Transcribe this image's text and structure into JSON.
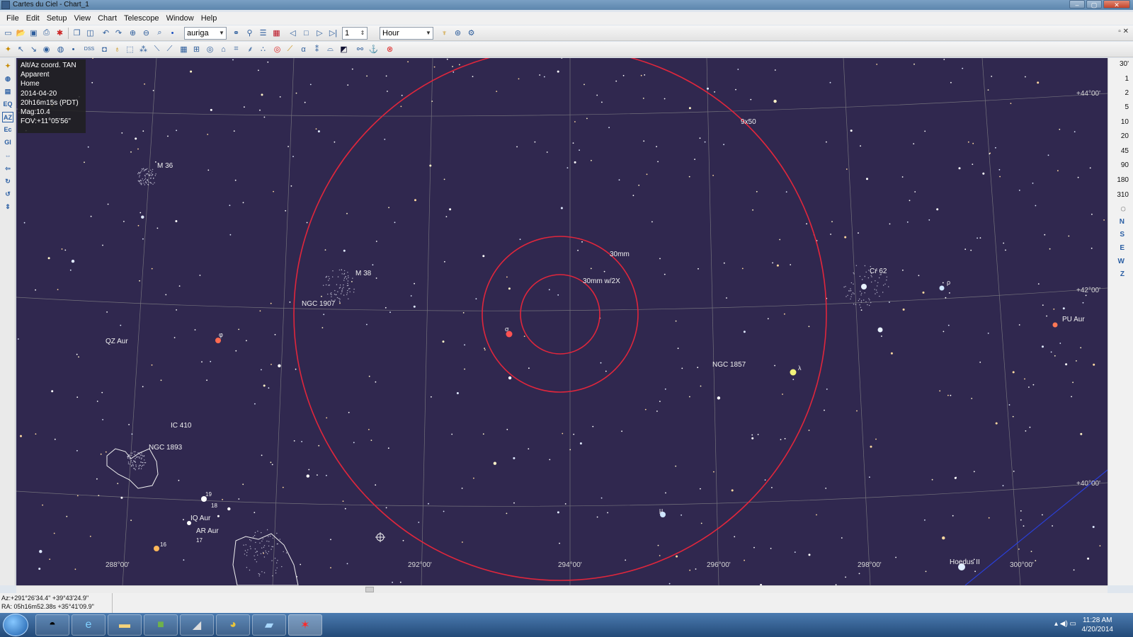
{
  "window": {
    "title": "Cartes du Ciel - Chart_1"
  },
  "menu": [
    "File",
    "Edit",
    "Setup",
    "View",
    "Chart",
    "Telescope",
    "Window",
    "Help"
  ],
  "toolbar": {
    "search_value": "auriga",
    "step_value": "1",
    "time_unit": "Hour",
    "dss_label": "DSS"
  },
  "left_toolbar": [
    "EQ",
    "AZ",
    "Ec",
    "Gl"
  ],
  "fov_scale": [
    "30'",
    "1",
    "2",
    "5",
    "10",
    "20",
    "45",
    "90",
    "180",
    "310"
  ],
  "directions": [
    "N",
    "S",
    "E",
    "W",
    "Z"
  ],
  "info": [
    "Alt/Az coord. TAN",
    "Apparent",
    "Home",
    "2014-04-20",
    "20h16m15s (PDT)",
    "Mag:10.4",
    "FOV:+11°05'56\""
  ],
  "objects": {
    "m36": "M 36",
    "m38": "M 38",
    "ngc1907": "NGC 1907",
    "qzaur": "QZ Aur",
    "cr62": "Cr 62",
    "puaur": "PU Aur",
    "ngc1857": "NGC 1857",
    "ic410": "IC 410",
    "ngc1893": "NGC 1893",
    "iqaur": "IQ Aur",
    "araur": "AR Aur",
    "hoedus": "Hoedus II",
    "star19": "19",
    "star18": "18",
    "star17": "17",
    "star16": "16",
    "sigma": "σ",
    "lambda": "λ",
    "mu": "μ",
    "rho": "ρ",
    "phi": "φ"
  },
  "eyepieces": {
    "finder": "9x50",
    "e30": "30mm",
    "e30x2": "30mm w/2X"
  },
  "grid": {
    "dec": [
      "+44°00'",
      "+42°00'",
      "+40°00'"
    ],
    "ra": [
      "288°00'",
      "292°00'",
      "294°00'",
      "296°00'",
      "298°00'",
      "300°00'"
    ]
  },
  "status": {
    "azalt": "Az:+291°26'34.4\" +39°43'24.9\"",
    "radec": "RA: 05h16m52.38s +35°41'09.9\""
  },
  "clock": {
    "time": "11:28 AM",
    "date": "4/20/2014"
  },
  "colors": {
    "sky": "#30284f",
    "eyepiece": "#e0263c",
    "grid": "#8a8a8a"
  }
}
